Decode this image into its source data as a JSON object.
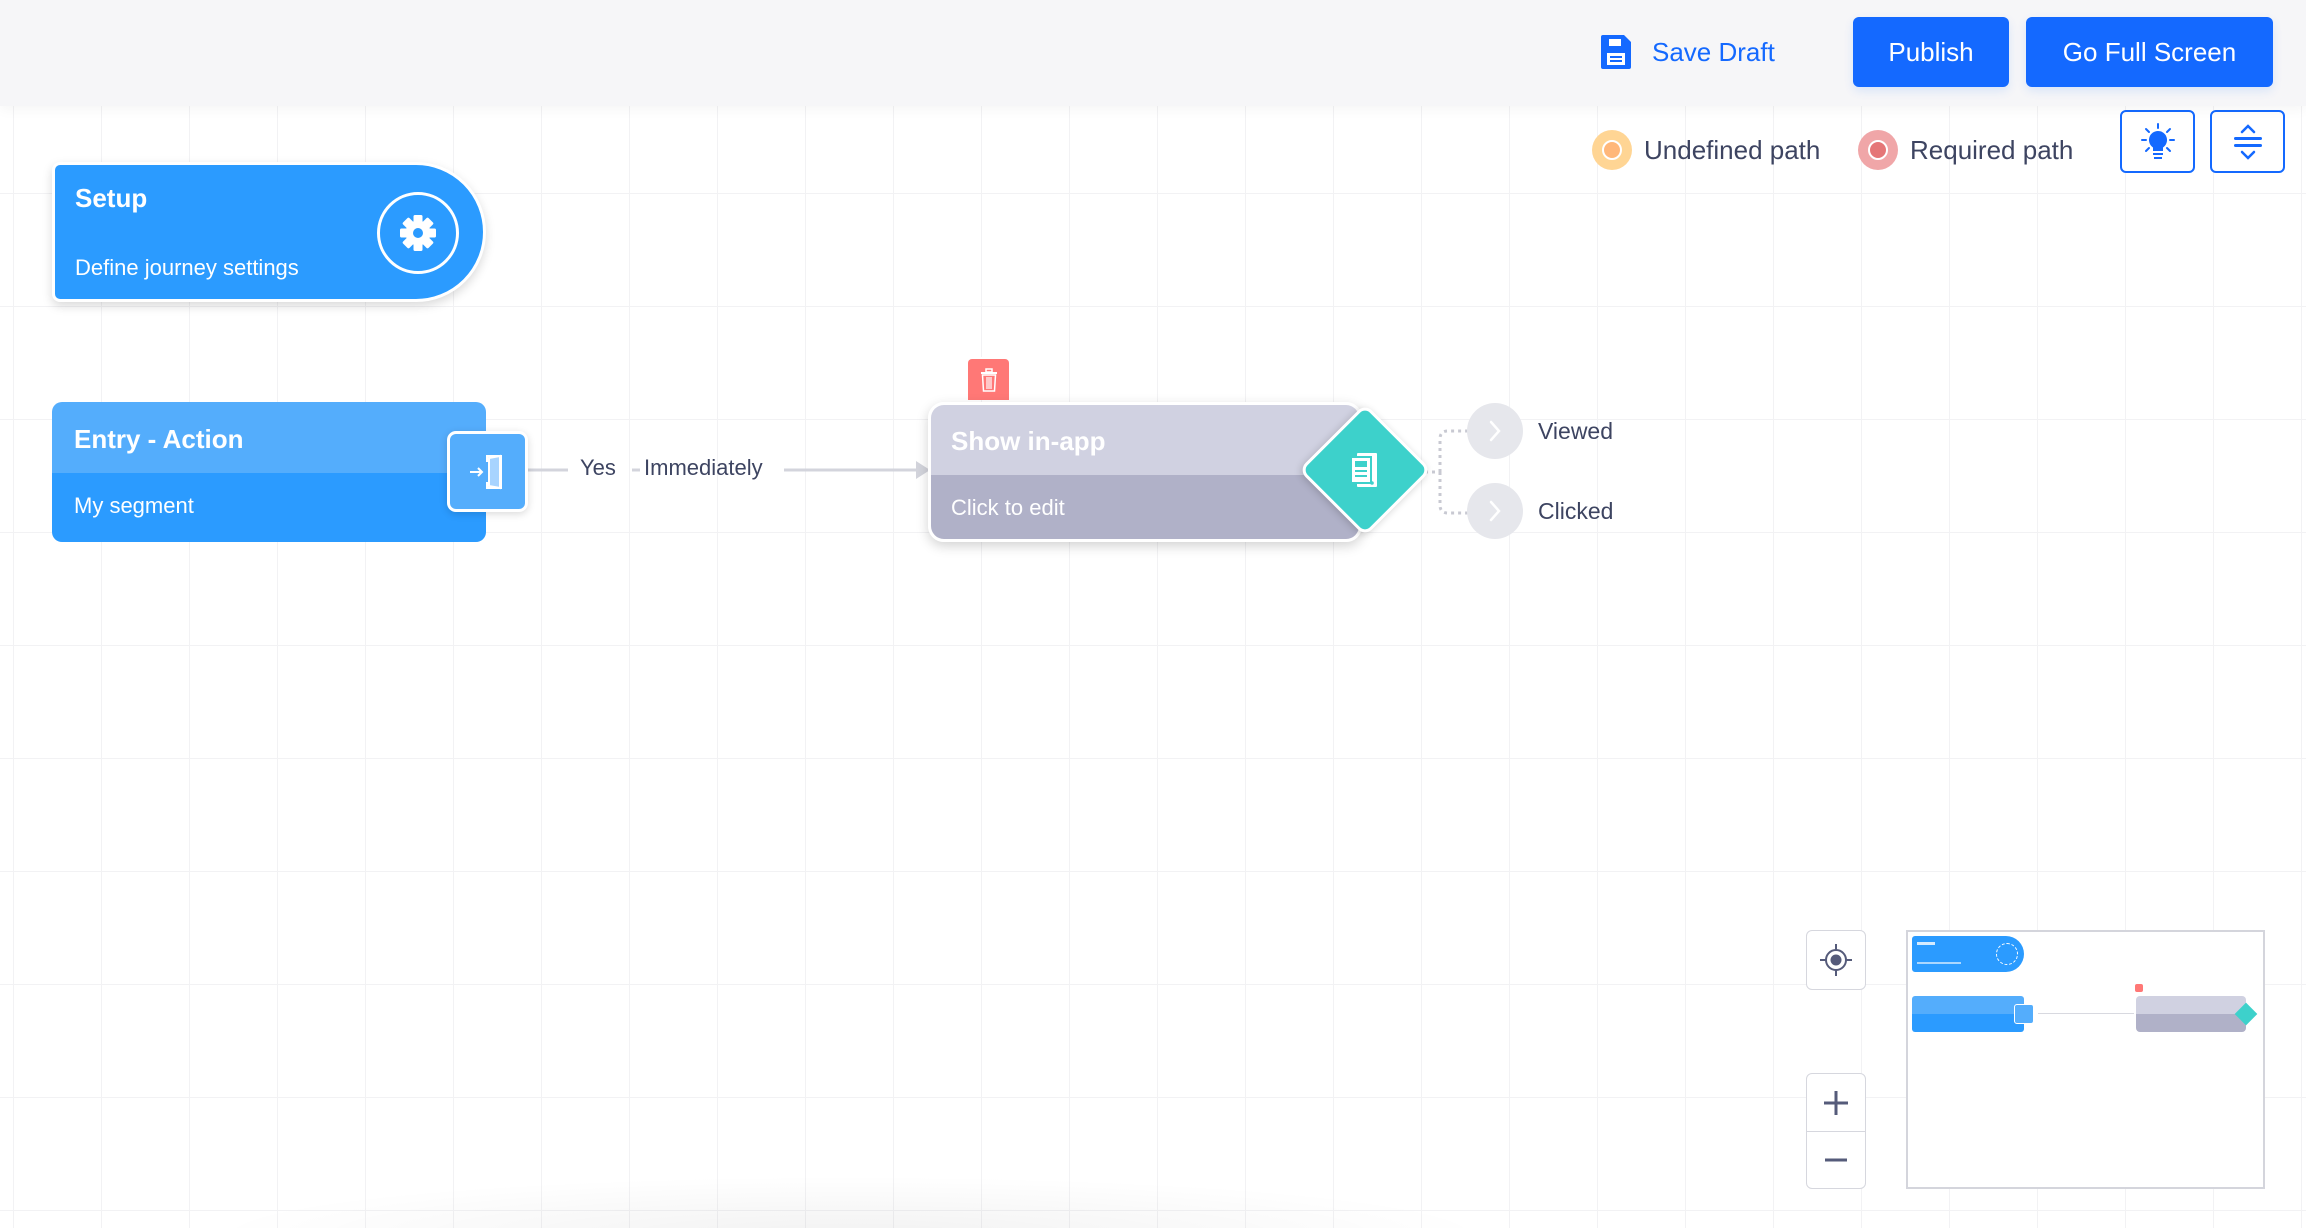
{
  "header": {
    "save_draft_label": "Save Draft",
    "save_draft_icon": "floppy-disk-icon",
    "publish_label": "Publish",
    "fullscreen_label": "Go Full Screen"
  },
  "legend": {
    "items": [
      {
        "label": "Undefined path",
        "outer_color": "#ffd594",
        "inner_color": "#ffb77a"
      },
      {
        "label": "Required path",
        "outer_color": "#f0a6a8",
        "inner_color": "#e57677"
      }
    ]
  },
  "toolbar": {
    "tips_icon": "lightbulb-icon",
    "collapse_icon": "expand-collapse-icon"
  },
  "nodes": {
    "setup": {
      "title": "Setup",
      "subtitle": "Define journey settings",
      "icon": "gear-icon"
    },
    "entry": {
      "title": "Entry - Action",
      "subtitle": "My segment",
      "icon": "entry-door-icon"
    },
    "edge": {
      "condition": "Yes",
      "separator": "-",
      "timing": "Immediately"
    },
    "inapp": {
      "title": "Show in-app",
      "subtitle": "Click to edit",
      "icon": "in-app-message-icon",
      "delete_icon": "trash-icon"
    },
    "branches": [
      {
        "label": "Viewed",
        "icon": "chevron-right-icon"
      },
      {
        "label": "Clicked",
        "icon": "chevron-right-icon"
      }
    ]
  },
  "colors": {
    "accent": "#1469ff",
    "node_blue": "#2b9bff",
    "node_blue_light": "#54adfc",
    "node_gray_top": "#d0d1e1",
    "node_gray_bottom": "#b0b1c8",
    "diamond_teal": "#3dd1cb",
    "delete_red": "#ff7876"
  },
  "controls": {
    "locate_icon": "crosshair-icon",
    "zoom_in_icon": "plus-icon",
    "zoom_out_icon": "minus-icon"
  },
  "minimap": {
    "label": "minimap"
  }
}
